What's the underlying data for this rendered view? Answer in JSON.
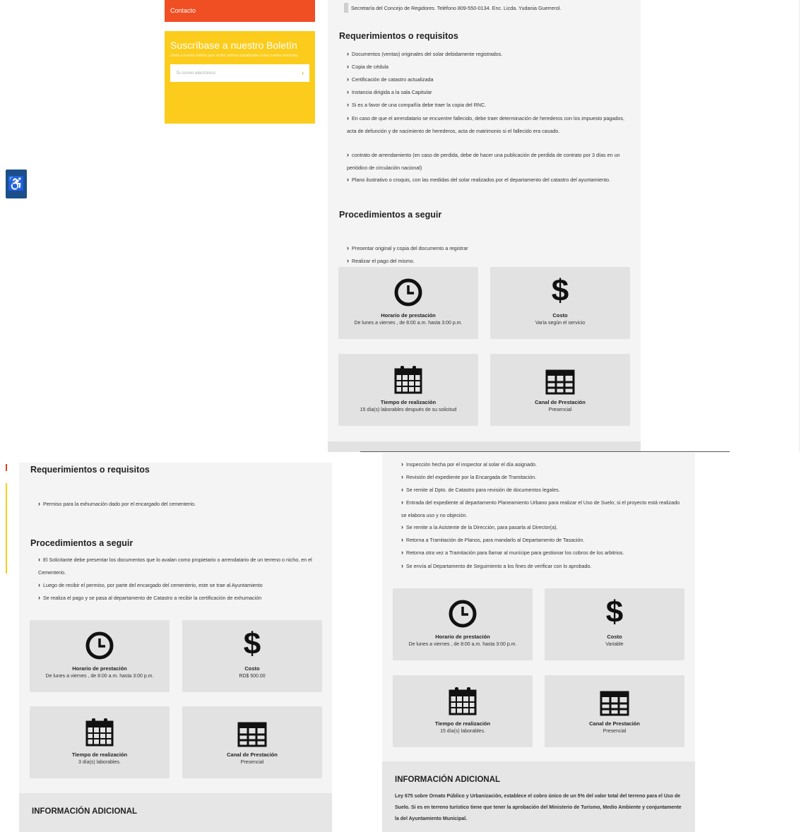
{
  "sidebar": {
    "contact": "Contacto",
    "newsletter_title": "Suscríbase a nuestro Boletín",
    "newsletter_text": "Únete a nuestro boletín para recibir noticias actualizadas sobre nuestro municipio.",
    "email_placeholder": "Tu correo electrónico",
    "submit_glyph": "›"
  },
  "accessibility_glyph": "♿",
  "panel1": {
    "top_line": "Secretaría del Concejo de Regidores. Teléfono 809-550-0134. Enc. Licda. Yudania Guerrerol.",
    "requirements_title": "Requerimientos o requisitos",
    "requirements": [
      "Documentos (ventas) originales del solar debidamente registrados.",
      "Copia de cédula",
      "Certificación de catastro actualizada",
      "Instancia dirigida a la sala Capitular",
      "Si es a favor de una compañía debe traer la copia del RNC.",
      "En caso de que el arrendatario se encuentre fallecido, debe traer determinación de herederos con los impuesto pagados, acta de defunción y de nacimiento de herederos, acta de matrimonio si el fallecido era casado.",
      "contrato de arrendamiento (en caso de perdida, debe de hacer una publicación de perdida de contrato por 3 días en un periódico de circulación nacional)",
      "Plano ilustrativo o croquis, con las medidas del solar realizados por el departamento del catastro del ayuntamiento."
    ],
    "procedure_title": "Procedimientos a seguir",
    "procedure": [
      "Presentar original y copia del documento a registrar",
      "Realizar el pago del mismo."
    ],
    "cards": {
      "schedule_label": "Horario de prestación",
      "schedule_value": "De lunes a viernes , de 8:00 a.m. hasta 3:00 p.m.",
      "cost_label": "Costo",
      "cost_value": "Varía según el servicio",
      "time_label": "Tiempo de realización",
      "time_value": "15 día(s) laborables después de su solicitud",
      "channel_label": "Canal de Prestación",
      "channel_value": "Presencial"
    }
  },
  "panel2": {
    "requirements_title": "Requerimientos o requisitos",
    "requirements": [
      "Permiso para la exhumación dado por el encargado del cementerio."
    ],
    "procedure_title": "Procedimientos a seguir",
    "procedure": [
      "El Solicitante debe presentar los documentos que lo avalan como propietario o arrendatario de un terreno o nicho, en el Cementerio.",
      "Luego de recibir el permiso, por parte del encargado del cementerio, este se trae al Ayuntamiento",
      "Se realiza el pago y se pasa al departamento de Catastro a recibir la certificación de exhumación"
    ],
    "cards": {
      "schedule_label": "Horario de prestación",
      "schedule_value": "De lunes a viernes , de 8:00 a.m. hasta 3:00 p.m.",
      "cost_label": "Costo",
      "cost_value": "RD$ 500.00",
      "time_label": "Tiempo de realización",
      "time_value": "3 día(s) laborables.",
      "channel_label": "Canal de Prestación",
      "channel_value": "Presencial"
    },
    "info_title": "INFORMACIÓN ADICIONAL"
  },
  "panel3": {
    "procedure": [
      "Inspección hecha por el inspector al solar el día asignado.",
      "Revisión del expediente por la Encargada de Tramitación.",
      "Se remite al Dpto. de Catastro para revisión de documentos legales.",
      "Entrada del expediente al departamento Planeamiento Urbano para realizar el Uso de Suelo; si el proyecto está realizado se elabora uso y no objeción.",
      "Se remite a la Asistente de la Dirección, para pasarla al Director(a).",
      "Retorna a Tramitación de Planos, para mandarlo al Departamento de Tasación.",
      "Retorna otra vez a Tramitación para llamar al munícipe para gestionar los cobros de los arbitrios.",
      "Se envía al Departamento de Seguimiento a los fines de verificar con lo aprobado."
    ],
    "cards": {
      "schedule_label": "Horario de prestación",
      "schedule_value": "De lunes a viernes , de 8:00 a.m. hasta 3:00 p.m.",
      "cost_label": "Costo",
      "cost_value": "Variable",
      "time_label": "Tiempo de realización",
      "time_value": "15 día(s) laborables.",
      "channel_label": "Canal de Prestación",
      "channel_value": "Presencial"
    },
    "info_title": "INFORMACIÓN ADICIONAL",
    "info_text": "Ley 675 sobre Ornato Público y Urbanización, establece el cobro único de un 5% del valor total del terreno para el Uso de Suelo. Si es en terreno turístico tiene que tener la aprobación del Ministerio de Turismo, Medio Ambiente y conjuntamente la del Ayuntamiento Municipal."
  },
  "icons": {
    "chevron": "›",
    "dollar": "$"
  },
  "colors": {
    "contact_bar": "#f04e23",
    "newsletter": "#fccc1c",
    "accessibility": "#1c4f8a",
    "card": "#e2e2e2"
  }
}
